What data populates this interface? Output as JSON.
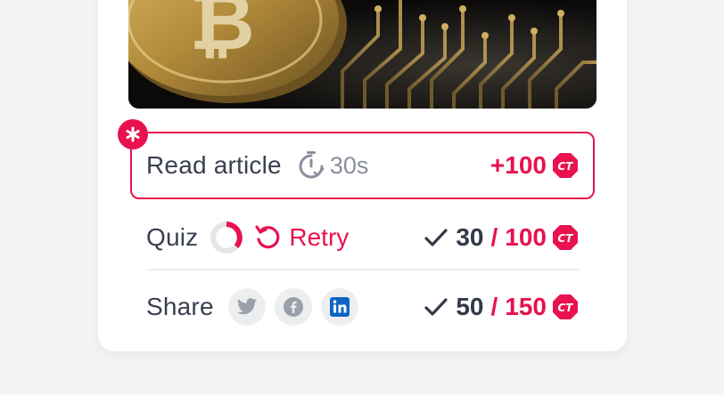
{
  "colors": {
    "accent": "#e8124f",
    "text": "#3a4050",
    "muted": "#8a8f9c",
    "card": "#ffffff",
    "background": "#f3f4f4"
  },
  "hero": {
    "icon": "bitcoin-coin-image"
  },
  "tasks": {
    "read": {
      "label": "Read article",
      "timer_icon": "timer-check-icon",
      "timer": "30s",
      "reward": "+100",
      "currency_icon": "ct-token-icon",
      "badge_icon": "asterisk-icon"
    },
    "quiz": {
      "label": "Quiz",
      "progress_icon": "progress-ring-icon",
      "retry_icon": "retry-icon",
      "retry_label": "Retry",
      "score": "30",
      "separator": "/",
      "max": "100",
      "currency_icon": "ct-token-icon"
    },
    "share": {
      "label": "Share",
      "icons": [
        "twitter-icon",
        "facebook-icon",
        "linkedin-icon"
      ],
      "score": "50",
      "separator": "/",
      "max": "150",
      "currency_icon": "ct-token-icon"
    }
  }
}
